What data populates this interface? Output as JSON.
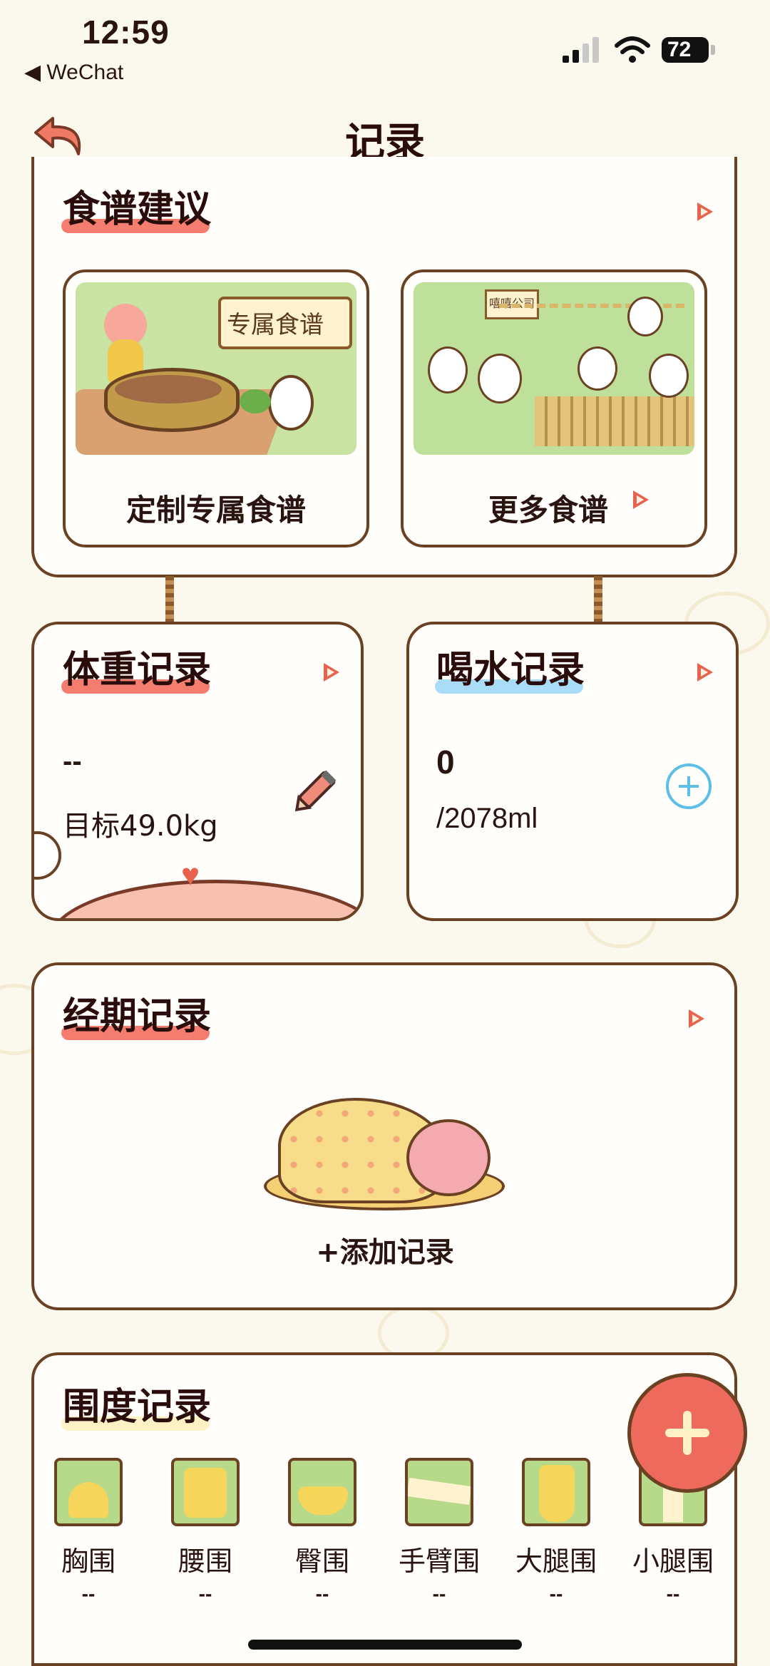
{
  "status_bar": {
    "time": "12:59",
    "back_app": "◀ WeChat",
    "battery": "72"
  },
  "header": {
    "title": "记录"
  },
  "recipe": {
    "title": "食谱建议",
    "card1": {
      "label": "定制专属食谱",
      "sign": "专属食谱"
    },
    "card2": {
      "label": "更多食谱",
      "sign": "嘻嘻公司"
    }
  },
  "weight": {
    "title": "体重记录",
    "value": "--",
    "target": "目标49.0kg"
  },
  "water": {
    "title": "喝水记录",
    "value": "0",
    "goal": "/2078ml"
  },
  "period": {
    "title": "经期记录",
    "add_label": "+添加记录"
  },
  "measurements": {
    "title": "围度记录",
    "items": [
      {
        "label": "胸围",
        "value": "--"
      },
      {
        "label": "腰围",
        "value": "--"
      },
      {
        "label": "臀围",
        "value": "--"
      },
      {
        "label": "手臂围",
        "value": "--"
      },
      {
        "label": "大腿围",
        "value": "--"
      },
      {
        "label": "小腿围",
        "value": "--"
      }
    ]
  },
  "colors": {
    "accent": "#e9624d",
    "border": "#6b4124",
    "water_blue": "#5bbfe8",
    "highlight_pink": "#f47d70"
  }
}
